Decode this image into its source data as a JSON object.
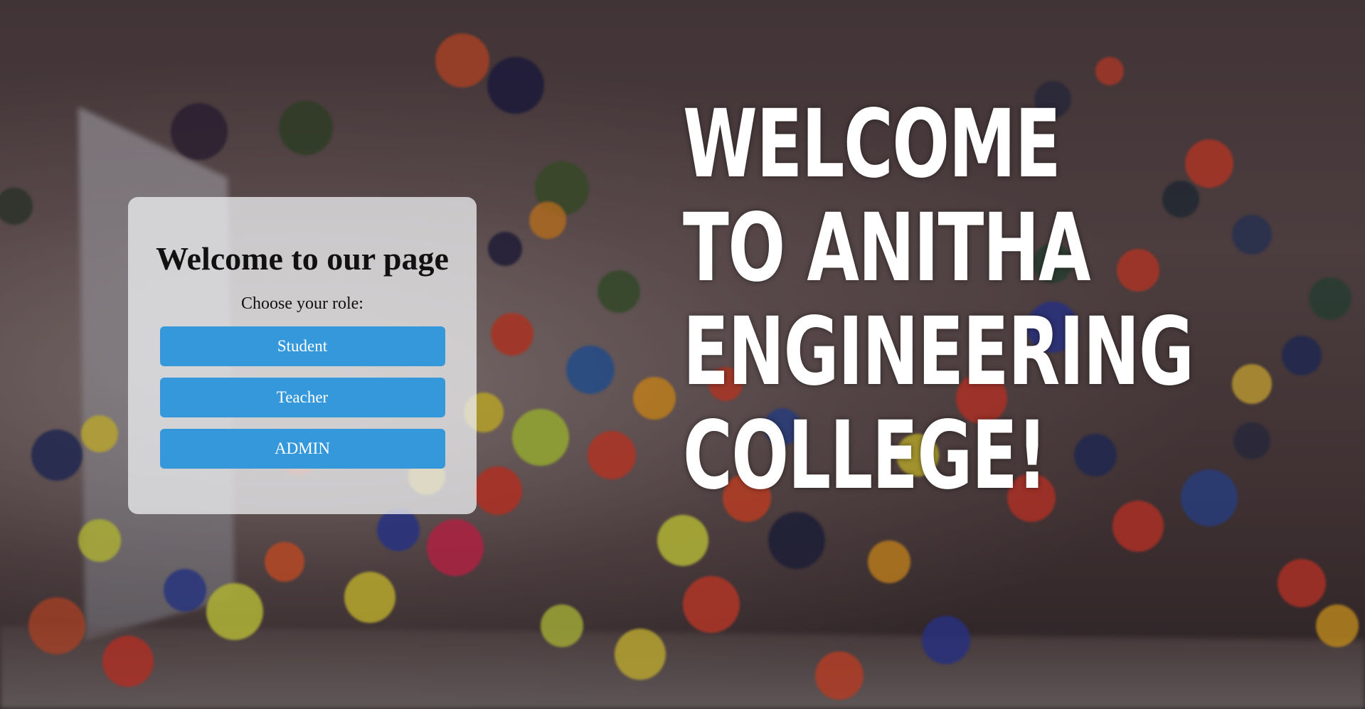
{
  "card": {
    "title": "Welcome to our page",
    "prompt": "Choose your role:",
    "roles": [
      {
        "label": "Student"
      },
      {
        "label": "Teacher"
      },
      {
        "label": "ADMIN"
      }
    ]
  },
  "headline": {
    "text": "WELCOME TO ANITHA ENGINEERING COLLEGE!"
  },
  "colors": {
    "button_bg": "#3498db",
    "button_text": "#ffffff",
    "card_bg": "#ececee",
    "headline_text": "#ffffff"
  }
}
